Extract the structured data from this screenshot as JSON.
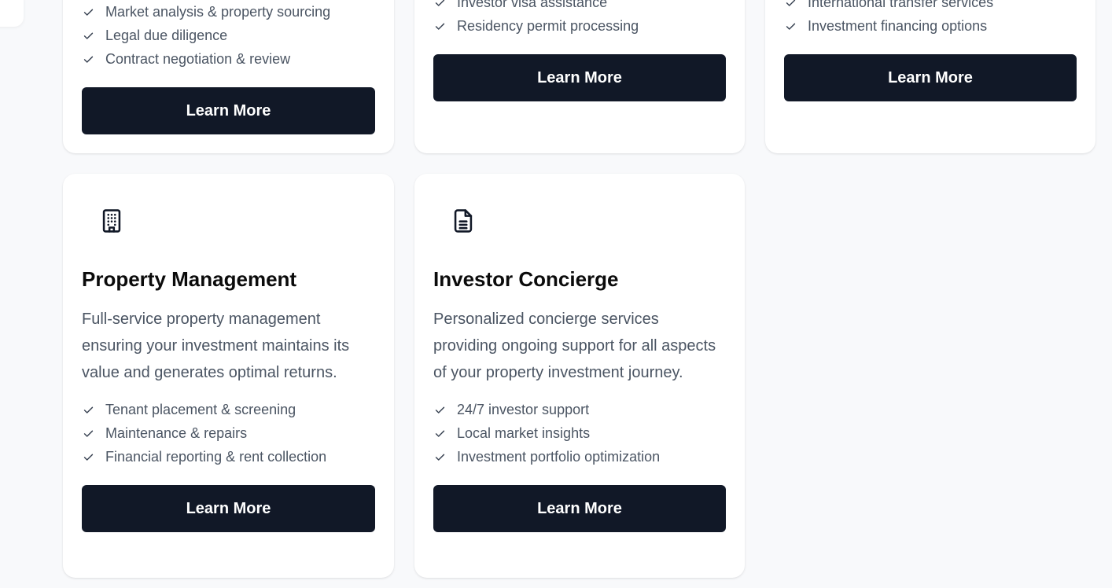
{
  "cards": [
    {
      "features": [
        "Market analysis & property sourcing",
        "Legal due diligence",
        "Contract negotiation & review"
      ],
      "button_label": "Learn More"
    },
    {
      "features": [
        "Investor visa assistance",
        "Residency permit processing"
      ],
      "button_label": "Learn More"
    },
    {
      "features": [
        "International transfer services",
        "Investment financing options"
      ],
      "button_label": "Learn More"
    },
    {
      "icon": "building-icon",
      "title": "Property Management",
      "description": "Full-service property management ensuring your investment maintains its value and generates optimal returns.",
      "features": [
        "Tenant placement & screening",
        "Maintenance & repairs",
        "Financial reporting & rent collection"
      ],
      "button_label": "Learn More"
    },
    {
      "icon": "document-icon",
      "title": "Investor Concierge",
      "description": "Personalized concierge services providing ongoing support for all aspects of your property investment journey.",
      "features": [
        "24/7 investor support",
        "Local market insights",
        "Investment portfolio optimization"
      ],
      "button_label": "Learn More"
    }
  ],
  "colors": {
    "background": "#f8f9fb",
    "card": "#ffffff",
    "button": "#111827",
    "button_text": "#ffffff",
    "body_text": "#4b5563",
    "title_text": "#0b0b0b"
  }
}
